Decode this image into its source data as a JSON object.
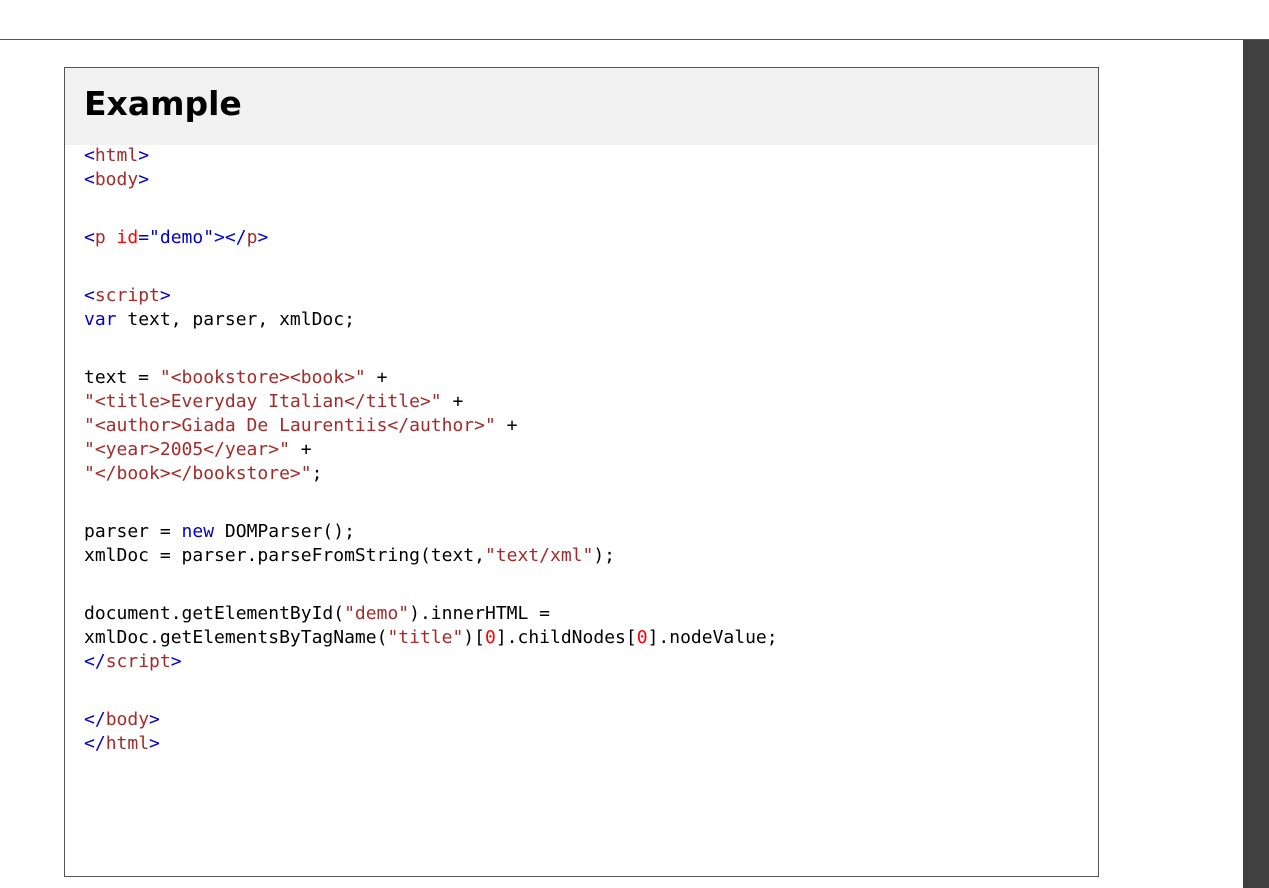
{
  "example": {
    "title": "Example",
    "code_lines": [
      [
        {
          "t": "<",
          "c": "br"
        },
        {
          "t": "html",
          "c": "tag"
        },
        {
          "t": ">",
          "c": "br"
        }
      ],
      [
        {
          "t": "<",
          "c": "br"
        },
        {
          "t": "body",
          "c": "tag"
        },
        {
          "t": ">",
          "c": "br"
        }
      ],
      [],
      [
        {
          "t": "<",
          "c": "br"
        },
        {
          "t": "p",
          "c": "tag"
        },
        {
          "t": " id",
          "c": "attr"
        },
        {
          "t": "=\"demo\">",
          "c": "br"
        },
        {
          "t": "</",
          "c": "br"
        },
        {
          "t": "p",
          "c": "tag"
        },
        {
          "t": ">",
          "c": "br"
        }
      ],
      [],
      [
        {
          "t": "<",
          "c": "br"
        },
        {
          "t": "script",
          "c": "tag"
        },
        {
          "t": ">",
          "c": "br"
        }
      ],
      [
        {
          "t": "var",
          "c": "kw"
        },
        {
          "t": " text, parser, xmlDoc;",
          "c": "plain"
        }
      ],
      [],
      [
        {
          "t": "text = ",
          "c": "plain"
        },
        {
          "t": "\"<bookstore><book>\"",
          "c": "str"
        },
        {
          "t": " +",
          "c": "plain"
        }
      ],
      [
        {
          "t": "\"<title>Everyday Italian</title>\"",
          "c": "str"
        },
        {
          "t": " +",
          "c": "plain"
        }
      ],
      [
        {
          "t": "\"<author>Giada De Laurentiis</author>\"",
          "c": "str"
        },
        {
          "t": " +",
          "c": "plain"
        }
      ],
      [
        {
          "t": "\"<year>2005</year>\"",
          "c": "str"
        },
        {
          "t": " +",
          "c": "plain"
        }
      ],
      [
        {
          "t": "\"</book></bookstore>\"",
          "c": "str"
        },
        {
          "t": ";",
          "c": "plain"
        }
      ],
      [],
      [
        {
          "t": "parser = ",
          "c": "plain"
        },
        {
          "t": "new",
          "c": "kw"
        },
        {
          "t": " DOMParser();",
          "c": "plain"
        }
      ],
      [
        {
          "t": "xmlDoc = parser.parseFromString(text,",
          "c": "plain"
        },
        {
          "t": "\"text/xml\"",
          "c": "str"
        },
        {
          "t": ");",
          "c": "plain"
        }
      ],
      [],
      [
        {
          "t": "document.getElementById(",
          "c": "plain"
        },
        {
          "t": "\"demo\"",
          "c": "str"
        },
        {
          "t": ").innerHTML =",
          "c": "plain"
        }
      ],
      [
        {
          "t": "xmlDoc.getElementsByTagName(",
          "c": "plain"
        },
        {
          "t": "\"title\"",
          "c": "str"
        },
        {
          "t": ")[",
          "c": "plain"
        },
        {
          "t": "0",
          "c": "num"
        },
        {
          "t": "].childNodes[",
          "c": "plain"
        },
        {
          "t": "0",
          "c": "num"
        },
        {
          "t": "].nodeValue;",
          "c": "plain"
        }
      ],
      [
        {
          "t": "</",
          "c": "br"
        },
        {
          "t": "script",
          "c": "tag"
        },
        {
          "t": ">",
          "c": "br"
        }
      ],
      [],
      [
        {
          "t": "</",
          "c": "br"
        },
        {
          "t": "body",
          "c": "tag"
        },
        {
          "t": ">",
          "c": "br"
        }
      ],
      [
        {
          "t": "</",
          "c": "br"
        },
        {
          "t": "html",
          "c": "tag"
        },
        {
          "t": ">",
          "c": "br"
        }
      ]
    ]
  },
  "colors": {
    "tag": "#a52a2a",
    "bracket": "#0000cd",
    "attribute": "#ff0000",
    "keyword": "#0000cd",
    "string": "#a52a2a",
    "number": "#ff0000",
    "header_bg": "#f1f1f1",
    "scrollbar": "#404040"
  }
}
